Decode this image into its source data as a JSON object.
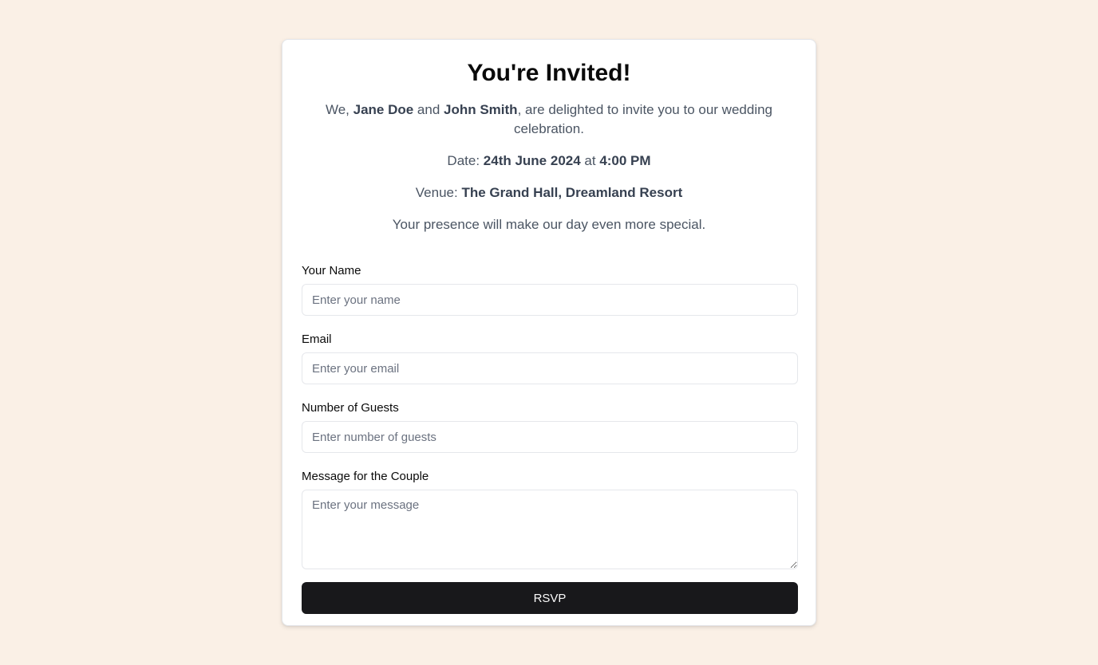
{
  "invitation": {
    "title": "You're Invited!",
    "intro_prefix": "We, ",
    "partner_one": "Jane Doe",
    "intro_and": " and ",
    "partner_two": "John Smith",
    "intro_suffix": ", are delighted to invite you to our wedding celebration.",
    "date_label": "Date: ",
    "date_value": "24th June 2024",
    "date_at": " at ",
    "time_value": "4:00 PM",
    "venue_label": "Venue: ",
    "venue_value": "The Grand Hall, Dreamland Resort",
    "closing": "Your presence will make our day even more special."
  },
  "form": {
    "name": {
      "label": "Your Name",
      "placeholder": "Enter your name",
      "value": ""
    },
    "email": {
      "label": "Email",
      "placeholder": "Enter your email",
      "value": ""
    },
    "guests": {
      "label": "Number of Guests",
      "placeholder": "Enter number of guests",
      "value": ""
    },
    "message": {
      "label": "Message for the Couple",
      "placeholder": "Enter your message",
      "value": ""
    },
    "submit_label": "RSVP"
  },
  "colors": {
    "page_background": "#faf0e6",
    "card_background": "#ffffff",
    "button_background": "#18181b",
    "button_text": "#fafafa",
    "muted_text": "#4b5563"
  }
}
